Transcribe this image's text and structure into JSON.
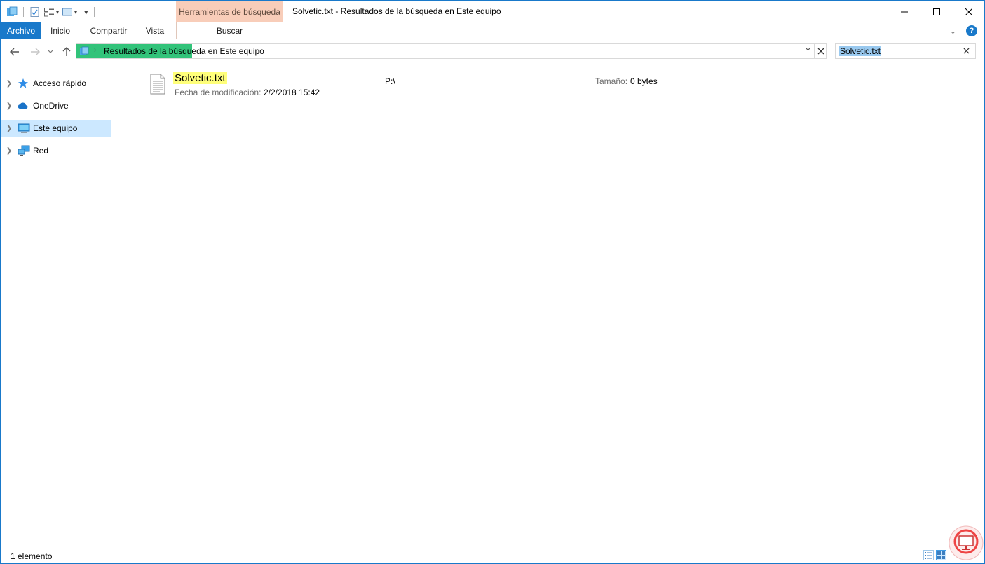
{
  "window": {
    "title": "Solvetic.txt - Resultados de la búsqueda en Este equipo",
    "context_tab_header": "Herramientas de búsqueda",
    "accent_color": "#1979ca",
    "context_color": "#f8cdb9"
  },
  "ribbon": {
    "tabs": [
      {
        "label": "Archivo"
      },
      {
        "label": "Inicio"
      },
      {
        "label": "Compartir"
      },
      {
        "label": "Vista"
      },
      {
        "label": "Buscar"
      }
    ],
    "help_label": "?"
  },
  "address": {
    "path": "Resultados de la búsqueda en Este equipo",
    "progress_color": "#32c37a"
  },
  "search": {
    "value": "Solvetic.txt"
  },
  "nav": {
    "items": [
      {
        "label": "Acceso rápido",
        "icon": "star-icon"
      },
      {
        "label": "OneDrive",
        "icon": "cloud-icon"
      },
      {
        "label": "Este equipo",
        "icon": "computer-icon",
        "selected": true
      },
      {
        "label": "Red",
        "icon": "network-icon"
      }
    ]
  },
  "results": [
    {
      "name": "Solvetic.txt",
      "date_label": "Fecha de modificación:",
      "date_value": "2/2/2018 15:42",
      "path": "P:\\",
      "size_label": "Tamaño:",
      "size_value": "0 bytes"
    }
  ],
  "status": {
    "count": "1 elemento"
  }
}
